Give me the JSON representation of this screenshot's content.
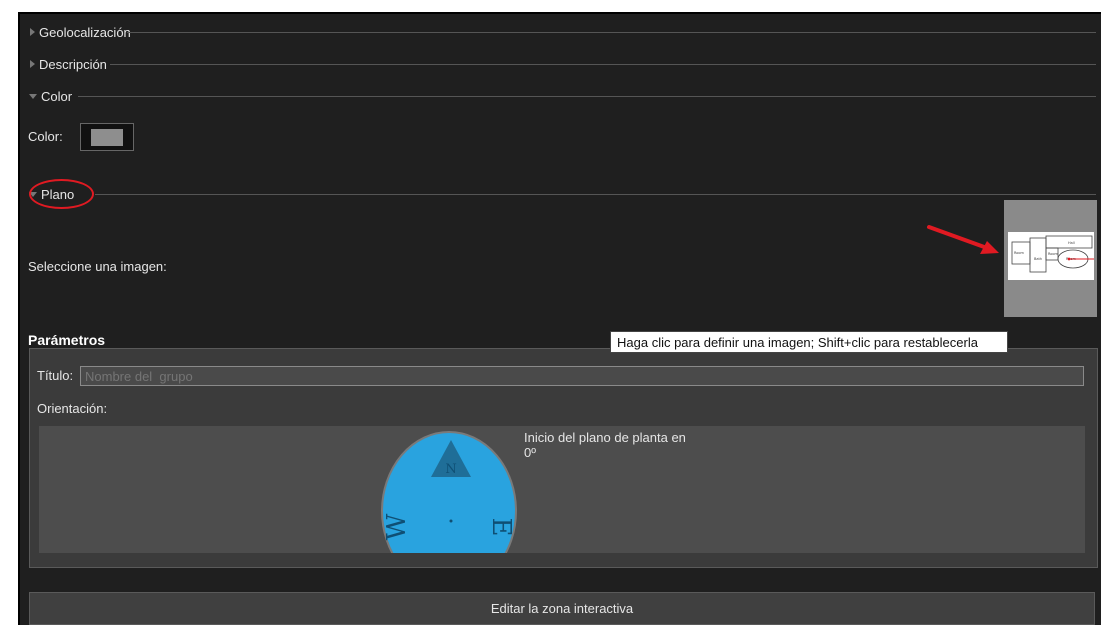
{
  "sections": {
    "geolocalizacion": "Geolocalización",
    "descripcion": "Descripción",
    "color": "Color",
    "plano": "Plano"
  },
  "color_panel": {
    "label": "Color:",
    "swatch_color": "#8e8e8e"
  },
  "plano_panel": {
    "select_image_label": "Seleccione una imagen:",
    "tooltip": "Haga clic para definir una imagen; Shift+clic para restablecerla"
  },
  "parametros": {
    "title": "Parámetros",
    "title_label": "Título:",
    "title_placeholder": "Nombre del  grupo",
    "orientation_label": "Orientación:",
    "floorplan_start_label": "Inicio del plano de planta en",
    "floorplan_start_value": "0º",
    "compass": {
      "n": "N",
      "e": "E",
      "w": "W"
    }
  },
  "edit_button_label": "Editar la zona interactiva",
  "thumbnail": {
    "texts": [
      "Hall",
      "Room",
      "Bath",
      "Room",
      "Hall",
      "Room"
    ]
  },
  "colors": {
    "annotation_red": "#e01a22",
    "compass_blue": "#29a3df"
  }
}
